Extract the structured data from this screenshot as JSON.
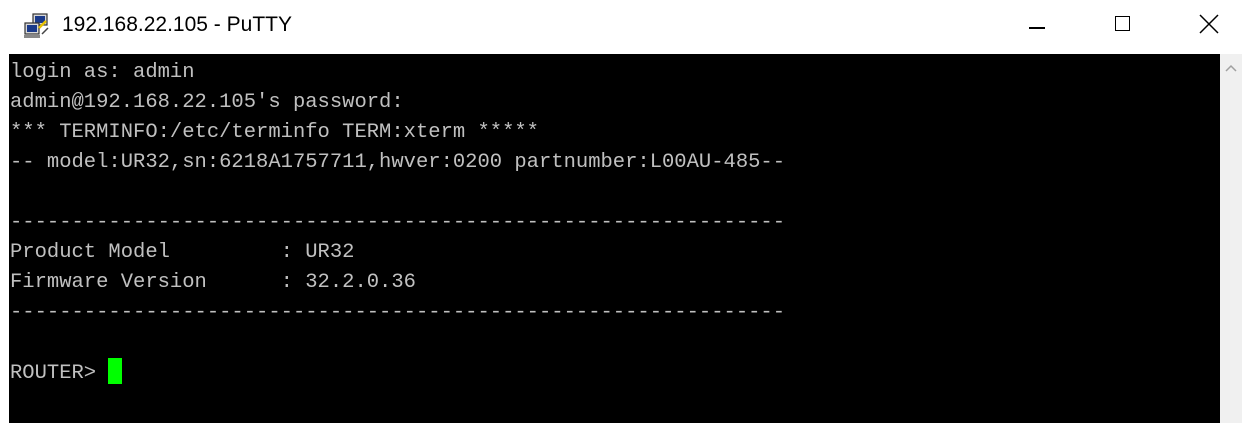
{
  "window": {
    "title": "192.168.22.105 - PuTTY",
    "app_icon": "putty-icon",
    "controls": {
      "minimize": "minimize-icon",
      "maximize": "maximize-icon",
      "close": "close-icon"
    }
  },
  "terminal": {
    "lines": [
      "login as: admin",
      "admin@192.168.22.105's password:",
      "*** TERMINFO:/etc/terminfo TERM:xterm *****",
      "-- model:UR32,sn:6218A1757711,hwver:0200 partnumber:L00AU-485--",
      "---------------------------------------------------------------",
      "Product Model         : UR32",
      "Firmware Version      : 32.2.0.36",
      "---------------------------------------------------------------"
    ],
    "prompt": "ROUTER> ",
    "colors": {
      "background": "#000000",
      "foreground": "#c0c0c0",
      "cursor": "#00ff00"
    }
  },
  "scrollbar": {
    "up_icon": "scroll-up-arrow-icon"
  }
}
